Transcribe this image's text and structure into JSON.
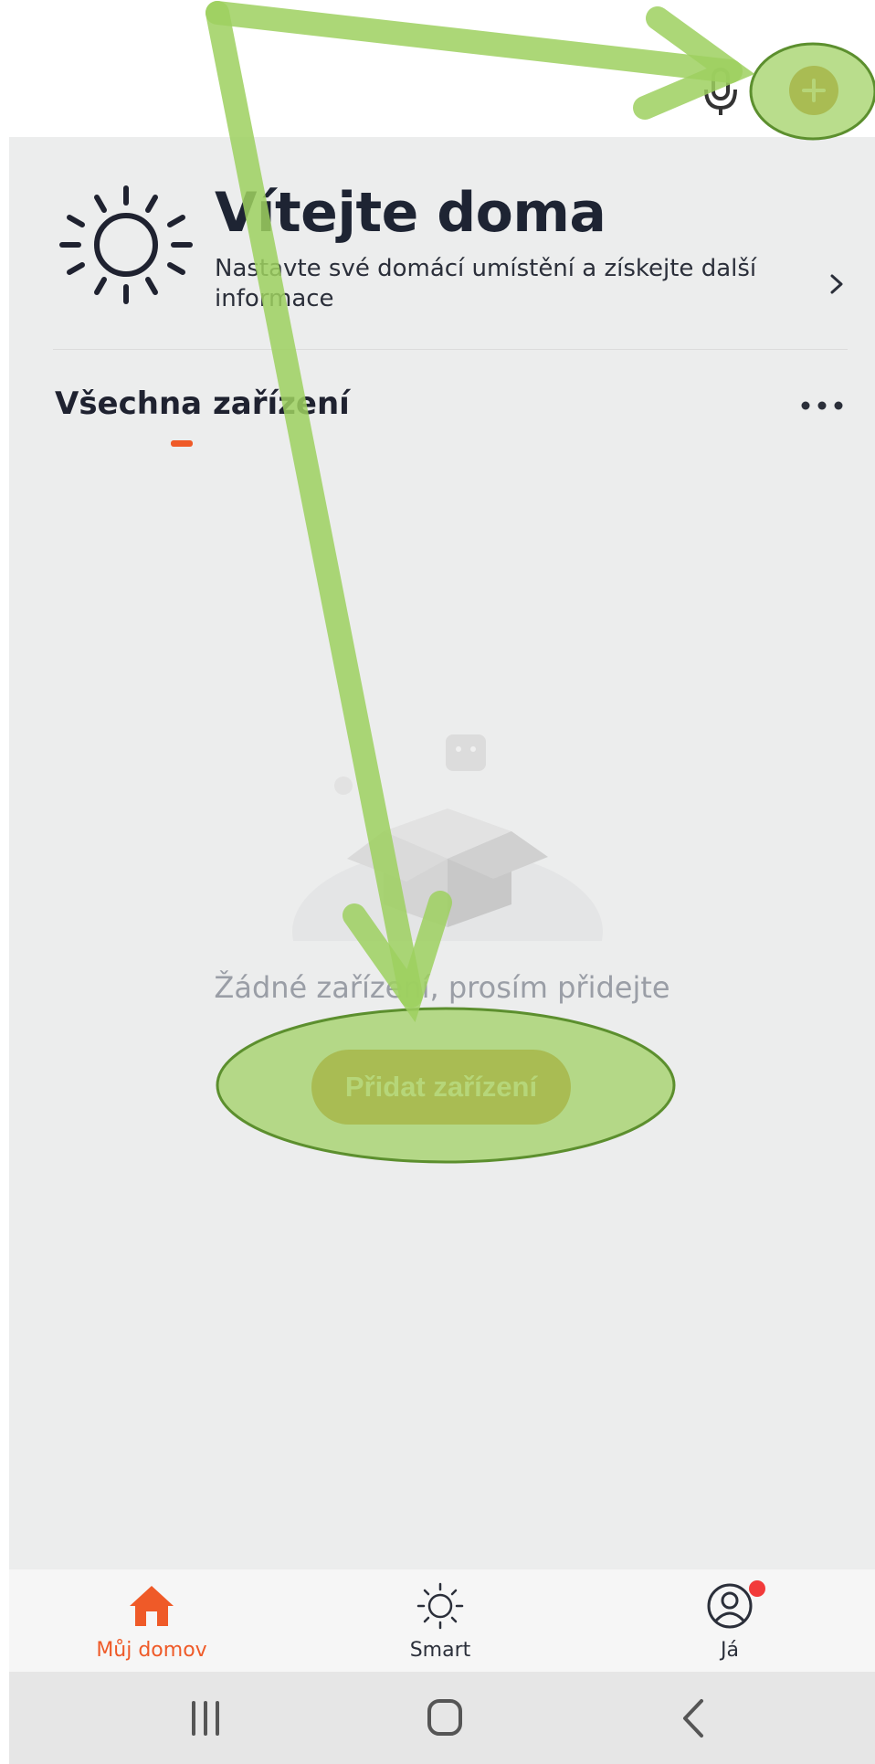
{
  "header": {
    "actions": [
      {
        "icon": "microphone-icon"
      },
      {
        "icon": "plus-icon",
        "color": "#c78a35"
      }
    ]
  },
  "welcome": {
    "title": "Vítejte doma",
    "subtitle": "Nastavte své domácí umístění a získejte další informace",
    "icon": "sun-icon"
  },
  "devices": {
    "tab_label": "Všechna zařízení",
    "empty_message": "Žádné zařízení, prosím přidejte",
    "add_button_label": "Přidat zařízení"
  },
  "bottom_nav": {
    "items": [
      {
        "label": "Můj domov",
        "icon": "home-icon",
        "active": true
      },
      {
        "label": "Smart",
        "icon": "smart-sun-icon",
        "active": false
      },
      {
        "label": "Já",
        "icon": "profile-icon",
        "active": false,
        "has_badge": true
      }
    ]
  },
  "colors": {
    "accent": "#ef5a28",
    "button": "#c78a35",
    "highlight_overlay": "#9ed05f"
  }
}
